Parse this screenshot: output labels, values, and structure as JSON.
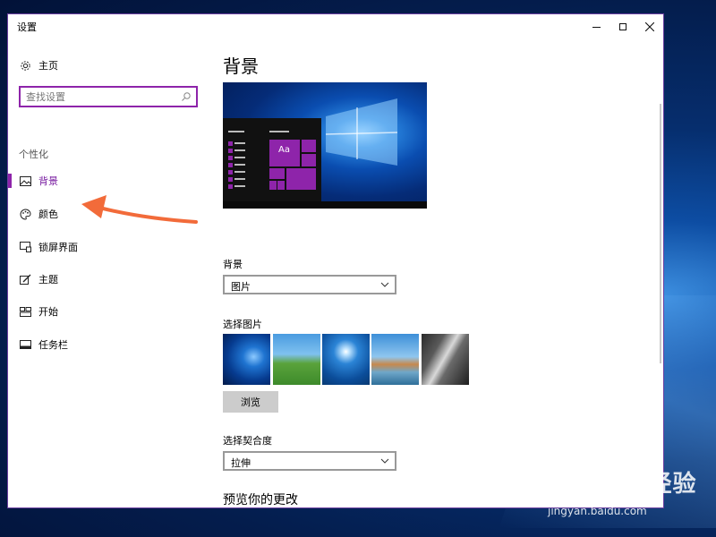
{
  "window": {
    "title": "设置"
  },
  "sidebar": {
    "home_label": "主页",
    "search_placeholder": "查找设置",
    "section_label": "个性化",
    "items": [
      {
        "label": "背景",
        "icon": "image-icon",
        "selected": true
      },
      {
        "label": "颜色",
        "icon": "palette-icon",
        "selected": false
      },
      {
        "label": "锁屏界面",
        "icon": "lock-screen-icon",
        "selected": false
      },
      {
        "label": "主题",
        "icon": "theme-icon",
        "selected": false
      },
      {
        "label": "开始",
        "icon": "start-icon",
        "selected": false
      },
      {
        "label": "任务栏",
        "icon": "taskbar-icon",
        "selected": false
      }
    ]
  },
  "main": {
    "page_title": "背景",
    "preview_tile_text": "Aa",
    "background_label": "背景",
    "background_value": "图片",
    "choose_picture_label": "选择图片",
    "browse_label": "浏览",
    "fit_label": "选择契合度",
    "fit_value": "拉伸",
    "preview_changes_title": "预览你的更改"
  },
  "watermark": {
    "logo_text": "Bai du 经验",
    "site_text": "jingyan.baidu.com"
  },
  "colors": {
    "accent": "#8e24aa",
    "arrow": "#f26b3a",
    "desktop": "#0a3f8f"
  }
}
